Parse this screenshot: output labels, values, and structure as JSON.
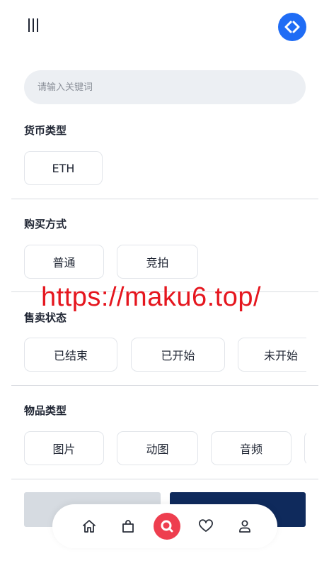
{
  "header": {
    "menu_icon": "menu-icon",
    "logo_icon": "code-arrows-icon",
    "accent": "#1f6cf5"
  },
  "search": {
    "placeholder": "请输入关键词"
  },
  "filters": [
    {
      "title": "货币类型",
      "options": [
        "ETH"
      ]
    },
    {
      "title": "购买方式",
      "options": [
        "普通",
        "竞拍"
      ]
    },
    {
      "title": "售卖状态",
      "options": [
        "已结束",
        "已开始",
        "未开始"
      ]
    },
    {
      "title": "物品类型",
      "options": [
        "图片",
        "动图",
        "音频"
      ]
    }
  ],
  "watermark": "https://maku6.top/",
  "actions": {
    "reset_color": "#d6dbe1",
    "confirm_color": "#0f2a5c"
  },
  "tabbar": {
    "items": [
      "home-icon",
      "bag-icon",
      "search-icon",
      "heart-icon",
      "user-icon"
    ],
    "active_color": "#ee3e4f"
  }
}
